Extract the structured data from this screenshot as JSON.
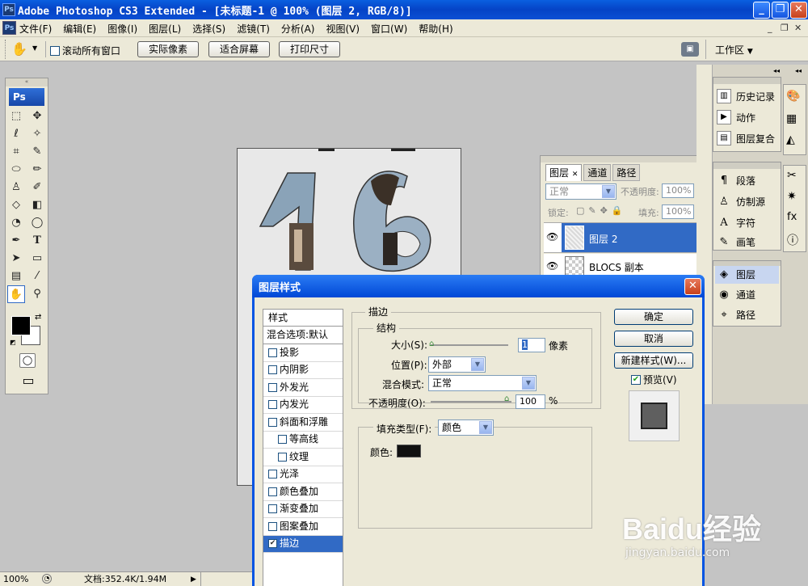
{
  "app": {
    "title": "Adobe Photoshop CS3 Extended - [未标题-1 @ 100% (图层 2, RGB/8)]",
    "ps_logo": "Ps"
  },
  "menu": [
    "文件(F)",
    "编辑(E)",
    "图像(I)",
    "图层(L)",
    "选择(S)",
    "滤镜(T)",
    "分析(A)",
    "视图(V)",
    "窗口(W)",
    "帮助(H)"
  ],
  "options": {
    "scroll_all": "滚动所有窗口",
    "actual_pixels": "实际像素",
    "fit_screen": "适合屏幕",
    "print_size": "打印尺寸",
    "workspace": "工作区"
  },
  "layers_panel": {
    "tabs": [
      "图层",
      "通道",
      "路径"
    ],
    "blend_mode": "正常",
    "opacity_label": "不透明度:",
    "opacity": "100%",
    "lock_label": "锁定:",
    "fill_label": "填充:",
    "fill": "100%",
    "layers": [
      "图层 2",
      "BLOCS 副本"
    ]
  },
  "right_dock": {
    "group1": [
      "历史记录",
      "动作",
      "图层复合"
    ],
    "group2": [
      "段落",
      "仿制源",
      "字符",
      "画笔"
    ],
    "group3": [
      "图层",
      "通道",
      "路径"
    ]
  },
  "dialog": {
    "title": "图层样式",
    "styles_header": "样式",
    "blend_options": "混合选项:默认",
    "styles": [
      {
        "label": "投影",
        "checked": false,
        "sub": false
      },
      {
        "label": "内阴影",
        "checked": false,
        "sub": false
      },
      {
        "label": "外发光",
        "checked": false,
        "sub": false
      },
      {
        "label": "内发光",
        "checked": false,
        "sub": false
      },
      {
        "label": "斜面和浮雕",
        "checked": false,
        "sub": false
      },
      {
        "label": "等高线",
        "checked": false,
        "sub": true
      },
      {
        "label": "纹理",
        "checked": false,
        "sub": true
      },
      {
        "label": "光泽",
        "checked": false,
        "sub": false
      },
      {
        "label": "颜色叠加",
        "checked": false,
        "sub": false
      },
      {
        "label": "渐变叠加",
        "checked": false,
        "sub": false
      },
      {
        "label": "图案叠加",
        "checked": false,
        "sub": false
      },
      {
        "label": "描边",
        "checked": true,
        "sub": false
      }
    ],
    "stroke_title": "描边",
    "structure_title": "结构",
    "size_label": "大小(S):",
    "size_value": "1",
    "size_unit": "像素",
    "position_label": "位置(P):",
    "position_value": "外部",
    "blend_label": "混合模式:",
    "blend_value": "正常",
    "opacity_label": "不透明度(O):",
    "opacity_value": "100",
    "opacity_unit": "%",
    "fill_type_label": "填充类型(F):",
    "fill_type_value": "颜色",
    "color_label": "颜色:",
    "stroke_color": "#111111",
    "ok": "确定",
    "cancel": "取消",
    "new_style": "新建样式(W)...",
    "preview": "预览(V)",
    "preview_checked": true
  },
  "status": {
    "zoom": "100%",
    "doc": "文档:352.4K/1.94M"
  },
  "watermark": {
    "brand": "Baidu经验",
    "url": "jingyan.baidu.com"
  },
  "colors": {
    "title_blue": "#0a52d8",
    "dialog_title": "#0054e3",
    "selection": "#316ac5",
    "face": "#ece9d8"
  }
}
